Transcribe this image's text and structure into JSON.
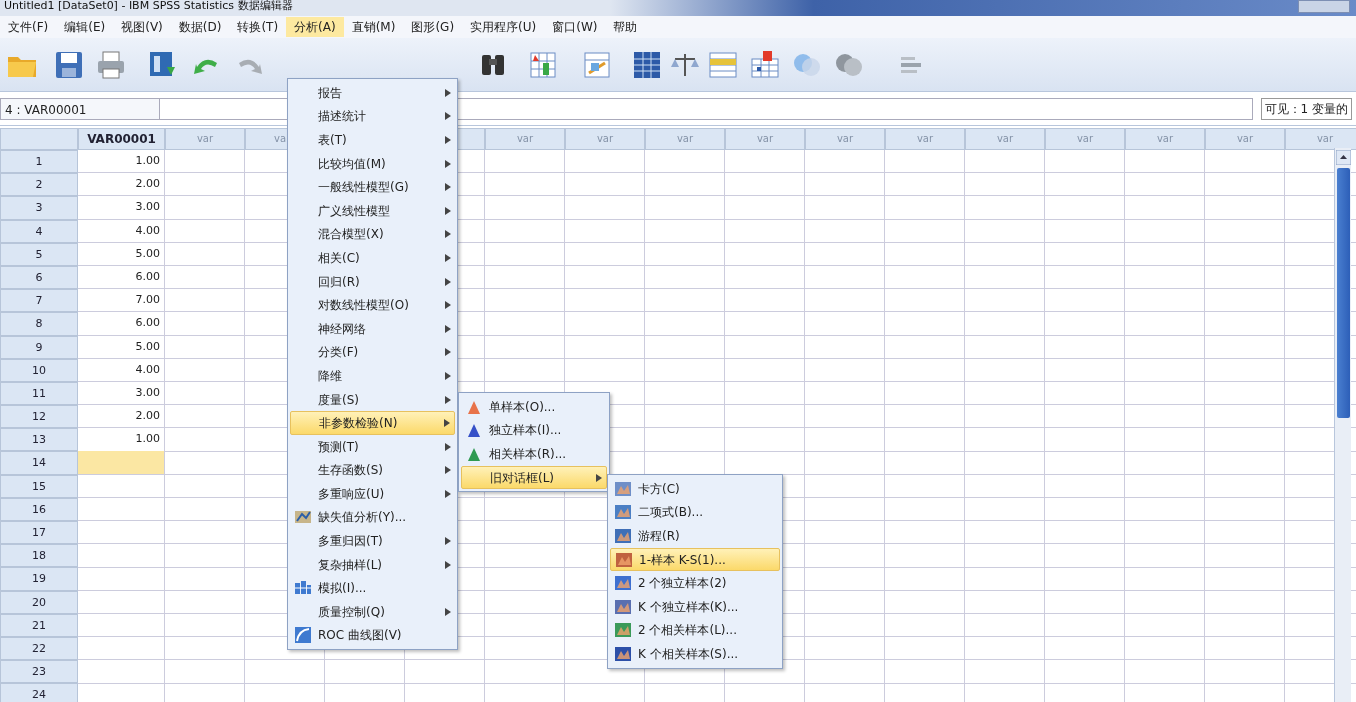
{
  "window": {
    "title": "Untitled1 [DataSet0] - IBM SPSS Statistics 数据编辑器"
  },
  "menu_bar": [
    {
      "label": "文件(F)",
      "selected": false
    },
    {
      "label": "编辑(E)",
      "selected": false
    },
    {
      "label": "视图(V)",
      "selected": false
    },
    {
      "label": "数据(D)",
      "selected": false
    },
    {
      "label": "转换(T)",
      "selected": false
    },
    {
      "label": "分析(A)",
      "selected": true
    },
    {
      "label": "直销(M)",
      "selected": false
    },
    {
      "label": "图形(G)",
      "selected": false
    },
    {
      "label": "实用程序(U)",
      "selected": false
    },
    {
      "label": "窗口(W)",
      "selected": false
    },
    {
      "label": "帮助",
      "selected": false
    }
  ],
  "cell_reference": "4 : VAR00001",
  "visible_count": "可见：1 变量的",
  "grid": {
    "columns": [
      {
        "label": "VAR00001",
        "kind": "variable"
      },
      {
        "label": "var",
        "kind": "empty"
      },
      {
        "label": "va",
        "kind": "cut"
      },
      {
        "label": "var",
        "kind": "empty"
      },
      {
        "label": "var",
        "kind": "empty"
      },
      {
        "label": "var",
        "kind": "empty"
      },
      {
        "label": "var",
        "kind": "empty"
      },
      {
        "label": "var",
        "kind": "empty"
      },
      {
        "label": "var",
        "kind": "empty"
      },
      {
        "label": "var",
        "kind": "empty"
      },
      {
        "label": "var",
        "kind": "empty"
      },
      {
        "label": "var",
        "kind": "empty"
      },
      {
        "label": "var",
        "kind": "empty"
      },
      {
        "label": "var",
        "kind": "empty"
      }
    ],
    "rows": [
      {
        "label": "1",
        "value": "1.00",
        "selected": false
      },
      {
        "label": "2",
        "value": "2.00",
        "selected": false
      },
      {
        "label": "3",
        "value": "3.00",
        "selected": false
      },
      {
        "label": "4",
        "value": "4.00",
        "selected": false
      },
      {
        "label": "5",
        "value": "5.00",
        "selected": false
      },
      {
        "label": "6",
        "value": "6.00",
        "selected": false
      },
      {
        "label": "7",
        "value": "7.00",
        "selected": false
      },
      {
        "label": "8",
        "value": "6.00",
        "selected": false
      },
      {
        "label": "9",
        "value": "5.00",
        "selected": false
      },
      {
        "label": "10",
        "value": "4.00",
        "selected": false
      },
      {
        "label": "11",
        "value": "3.00",
        "selected": false
      },
      {
        "label": "12",
        "value": "2.00",
        "selected": false
      },
      {
        "label": "13",
        "value": "1.00",
        "selected": false
      },
      {
        "label": "14",
        "selected": true
      },
      {
        "label": "15",
        "selected": false
      },
      {
        "label": "16",
        "selected": false
      },
      {
        "label": "17",
        "selected": false
      },
      {
        "label": "18",
        "selected": false
      },
      {
        "label": "19",
        "selected": false
      },
      {
        "label": "20",
        "selected": false
      },
      {
        "label": "21",
        "selected": false
      },
      {
        "label": "22",
        "selected": false
      },
      {
        "label": "23",
        "selected": false
      },
      {
        "label": "24",
        "selected": false
      }
    ]
  },
  "analyze_menu": [
    {
      "label": "报告",
      "kind": "submenu",
      "selected": false
    },
    {
      "label": "描述统计",
      "kind": "submenu",
      "selected": false
    },
    {
      "label": "表(T)",
      "kind": "submenu",
      "selected": false
    },
    {
      "label": "比较均值(M)",
      "kind": "submenu",
      "selected": false
    },
    {
      "label": "一般线性模型(G)",
      "kind": "submenu",
      "selected": false
    },
    {
      "label": "广义线性模型",
      "kind": "submenu",
      "selected": false
    },
    {
      "label": "混合模型(X)",
      "kind": "submenu",
      "selected": false
    },
    {
      "label": "相关(C)",
      "kind": "submenu",
      "selected": false
    },
    {
      "label": "回归(R)",
      "kind": "submenu",
      "selected": false
    },
    {
      "label": "对数线性模型(O)",
      "kind": "submenu",
      "selected": false
    },
    {
      "label": "神经网络",
      "kind": "submenu",
      "selected": false
    },
    {
      "label": "分类(F)",
      "kind": "submenu",
      "selected": false
    },
    {
      "label": "降维",
      "kind": "submenu",
      "selected": false
    },
    {
      "label": "度量(S)",
      "kind": "submenu",
      "selected": false
    },
    {
      "label": "非参数检验(N)",
      "kind": "submenu",
      "selected": true
    },
    {
      "label": "预测(T)",
      "kind": "submenu",
      "selected": false
    },
    {
      "label": "生存函数(S)",
      "kind": "submenu",
      "selected": false
    },
    {
      "label": "多重响应(U)",
      "kind": "submenu",
      "selected": false
    },
    {
      "label": "缺失值分析(Y)...",
      "kind": "command",
      "selected": false
    },
    {
      "label": "多重归因(T)",
      "kind": "submenu",
      "selected": false
    },
    {
      "label": "复杂抽样(L)",
      "kind": "submenu",
      "selected": false
    },
    {
      "label": "模拟(I)...",
      "kind": "command",
      "selected": false
    },
    {
      "label": "质量控制(Q)",
      "kind": "submenu",
      "selected": false
    },
    {
      "label": "ROC 曲线图(V)",
      "kind": "command",
      "selected": false
    }
  ],
  "nonparametric_menu": [
    {
      "label": "单样本(O)...",
      "kind": "command",
      "selected": false
    },
    {
      "label": "独立样本(I)...",
      "kind": "command",
      "selected": false
    },
    {
      "label": "相关样本(R)...",
      "kind": "command",
      "selected": false
    },
    {
      "label": "旧对话框(L)",
      "kind": "submenu",
      "selected": true
    }
  ],
  "legacy_dialogs_menu": [
    {
      "label": "卡方(C)",
      "selected": false
    },
    {
      "label": "二项式(B)...",
      "selected": false
    },
    {
      "label": "游程(R)",
      "selected": false
    },
    {
      "label": "1-样本 K-S(1)...",
      "selected": true
    },
    {
      "label": "2 个独立样本(2)",
      "selected": false
    },
    {
      "label": "K 个独立样本(K)...",
      "selected": false
    },
    {
      "label": "2 个相关样本(L)...",
      "selected": false
    },
    {
      "label": "K 个相关样本(S)...",
      "selected": false
    }
  ]
}
